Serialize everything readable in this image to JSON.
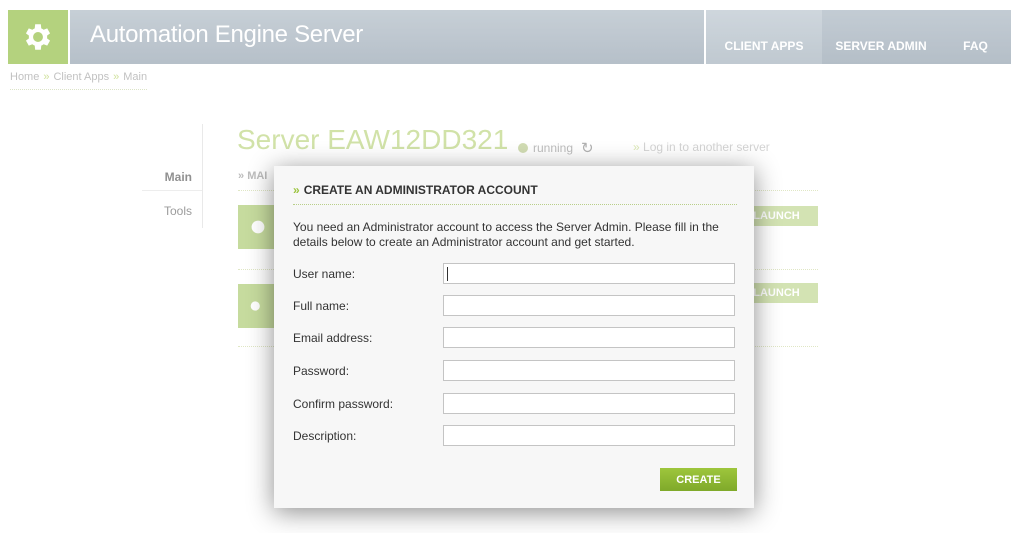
{
  "header": {
    "title": "Automation Engine Server",
    "logo_icon": "gear-icon",
    "nav": [
      {
        "label": "CLIENT APPS"
      },
      {
        "label": "SERVER ADMIN"
      },
      {
        "label": "FAQ"
      }
    ]
  },
  "breadcrumb": [
    "Home",
    "Client Apps",
    "Main"
  ],
  "sidenav": {
    "items": [
      {
        "label": "Main"
      },
      {
        "label": "Tools"
      }
    ]
  },
  "server": {
    "name": "Server EAW12DD321",
    "status": "running",
    "login_link": "Log in to another server",
    "section_label": "MAI",
    "launch_labels": [
      "LAUNCH",
      "LAUNCH"
    ]
  },
  "modal": {
    "title": "CREATE AN ADMINISTRATOR ACCOUNT",
    "description": "You need an Administrator account to access the Server Admin. Please fill in the details below to create an Administrator account and get started.",
    "fields": [
      {
        "label": "User name:",
        "value": ""
      },
      {
        "label": "Full name:",
        "value": ""
      },
      {
        "label": "Email address:",
        "value": ""
      },
      {
        "label": "Password:",
        "value": ""
      },
      {
        "label": "Confirm password:",
        "value": ""
      },
      {
        "label": "Description:",
        "value": ""
      }
    ],
    "submit_label": "CREATE"
  },
  "colors": {
    "accent_green": "#8dbb3a",
    "header_gray": "#9aa8b5"
  }
}
